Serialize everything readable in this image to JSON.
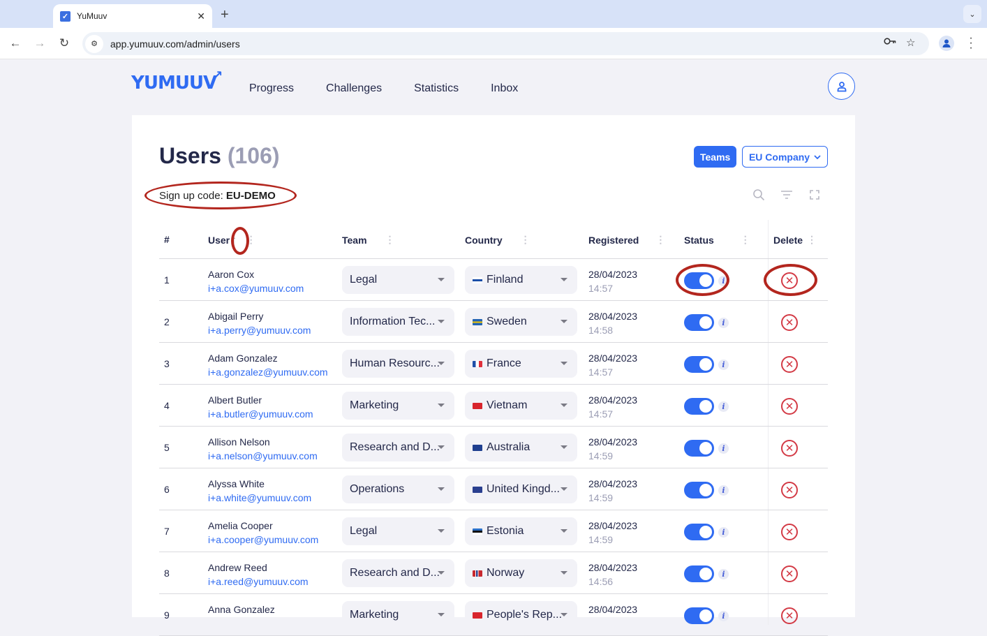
{
  "browser": {
    "tab_title": "YuMuuv",
    "url": "app.yumuuv.com/admin/users",
    "icons": [
      "back-icon",
      "forward-icon",
      "reload-icon",
      "site-info-icon",
      "password-key-icon",
      "bookmark-star-icon",
      "profile-icon",
      "menu-icon",
      "tab-search-icon"
    ]
  },
  "app": {
    "logo": "YUMUUV",
    "nav": [
      "Progress",
      "Challenges",
      "Statistics",
      "Inbox"
    ]
  },
  "page": {
    "title": "Users",
    "count": "(106)",
    "signup_label": "Sign up code:",
    "signup_code": "EU-DEMO",
    "teams_button": "Teams",
    "company_select": "EU Company"
  },
  "table": {
    "columns": [
      "#",
      "User",
      "Team",
      "Country",
      "Registered",
      "Status",
      "Delete"
    ],
    "sort": {
      "column": "User",
      "direction": "ascending"
    },
    "rows": [
      {
        "num": "1",
        "name": "Aaron Cox",
        "email": "i+a.cox@yumuuv.com",
        "team": "Legal",
        "country": "Finland",
        "flag": "FI",
        "date": "28/04/2023",
        "time": "14:57",
        "active": true
      },
      {
        "num": "2",
        "name": "Abigail Perry",
        "email": "i+a.perry@yumuuv.com",
        "team": "Information Tec...",
        "country": "Sweden",
        "flag": "SE",
        "date": "28/04/2023",
        "time": "14:58",
        "active": true
      },
      {
        "num": "3",
        "name": "Adam Gonzalez",
        "email": "i+a.gonzalez@yumuuv.com",
        "team": "Human Resourc...",
        "country": "France",
        "flag": "FR",
        "date": "28/04/2023",
        "time": "14:57",
        "active": true
      },
      {
        "num": "4",
        "name": "Albert Butler",
        "email": "i+a.butler@yumuuv.com",
        "team": "Marketing",
        "country": "Vietnam",
        "flag": "VN",
        "date": "28/04/2023",
        "time": "14:57",
        "active": true
      },
      {
        "num": "5",
        "name": "Allison Nelson",
        "email": "i+a.nelson@yumuuv.com",
        "team": "Research and D...",
        "country": "Australia",
        "flag": "AU",
        "date": "28/04/2023",
        "time": "14:59",
        "active": true
      },
      {
        "num": "6",
        "name": "Alyssa White",
        "email": "i+a.white@yumuuv.com",
        "team": "Operations",
        "country": "United Kingd...",
        "flag": "GB",
        "date": "28/04/2023",
        "time": "14:59",
        "active": true
      },
      {
        "num": "7",
        "name": "Amelia Cooper",
        "email": "i+a.cooper@yumuuv.com",
        "team": "Legal",
        "country": "Estonia",
        "flag": "EE",
        "date": "28/04/2023",
        "time": "14:59",
        "active": true
      },
      {
        "num": "8",
        "name": "Andrew Reed",
        "email": "i+a.reed@yumuuv.com",
        "team": "Research and D...",
        "country": "Norway",
        "flag": "NO",
        "date": "28/04/2023",
        "time": "14:56",
        "active": true
      },
      {
        "num": "9",
        "name": "Anna Gonzalez",
        "email": "",
        "team": "Marketing",
        "country": "People's Rep...",
        "flag": "CN",
        "date": "28/04/2023",
        "time": "",
        "active": true
      }
    ]
  },
  "colors": {
    "accent": "#2f6bf2",
    "delete": "#d33a45",
    "annotation": "#b3261e",
    "text": "#232849",
    "muted": "#9b9db4"
  }
}
